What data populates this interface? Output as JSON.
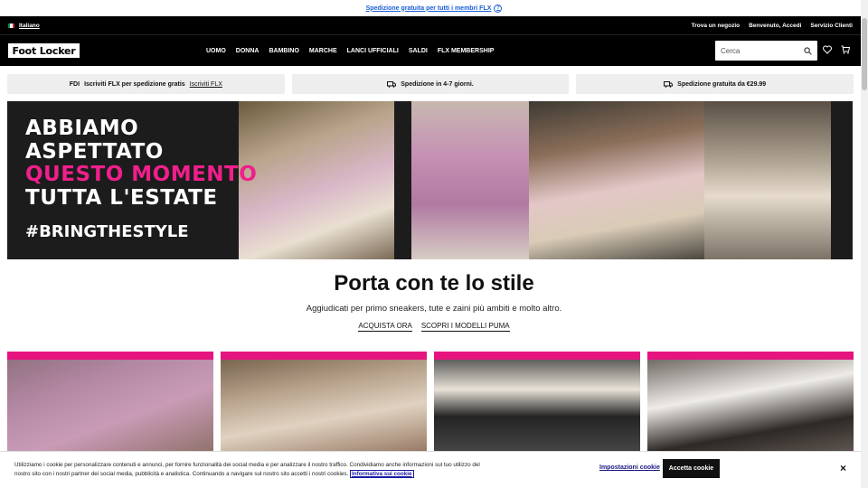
{
  "topbar": {
    "shipping_link": "Spedizione gratuita per tutti i membri FLX"
  },
  "utility": {
    "language": "Italiano",
    "links": [
      "Trova un negozio",
      "Benvenuto, Accedi",
      "Servizio Clienti"
    ]
  },
  "nav": {
    "logo": "Foot Locker",
    "items": [
      "UOMO",
      "DONNA",
      "BAMBINO",
      "MARCHE",
      "LANCI UFFICIALI",
      "SALDI",
      "FLX MEMBERSHIP"
    ],
    "search_placeholder": "Cerca",
    "icons": [
      "search-icon",
      "heart-icon",
      "cart-icon"
    ]
  },
  "promos": [
    {
      "icon": "flx-icon",
      "icon_text": "FDI",
      "text": "Iscriviti FLX per spedizione gratis",
      "link": "Iscriviti FLX"
    },
    {
      "icon": "truck-icon",
      "text": "Spedizione in 4-7 giorni."
    },
    {
      "icon": "truck-icon",
      "text": "Spedizione gratuita da €29.99"
    }
  ],
  "hero": {
    "lines": [
      "ABBIAMO",
      "ASPETTATO"
    ],
    "pink_line": "QUESTO MOMENTO",
    "line4": "TUTTA L'ESTATE",
    "hashtag": "#BRINGTHESTYLE"
  },
  "headline": {
    "title": "Porta con te lo stile",
    "subtitle": "Aggiudicati per primo sneakers, tute e zaini più ambiti e molto altro.",
    "cta_shop": "ACQUISTA ORA",
    "cta_puma": "SCOPRI I MODELLI PUMA"
  },
  "cookie": {
    "message": "Utilizziamo i cookie per personalizzare contenuti e annunci, per fornire funzionalità dei social media e per analizzare il nostro traffico. Condividiamo anche informazioni sul tuo utilizzo del nostro sito con i nostri partner dei social media, pubblicità e analistica. Continuando a navigare sul nostro sito accetti i nostri cookies.",
    "policy_link": "Informativa sui cookie",
    "settings": "Impostazioni cookie",
    "accept": "Accetta cookie",
    "close": "×"
  },
  "colors": {
    "brand_black": "#000000",
    "accent_pink": "#f01f8c",
    "link_blue": "#1a5fd6"
  }
}
